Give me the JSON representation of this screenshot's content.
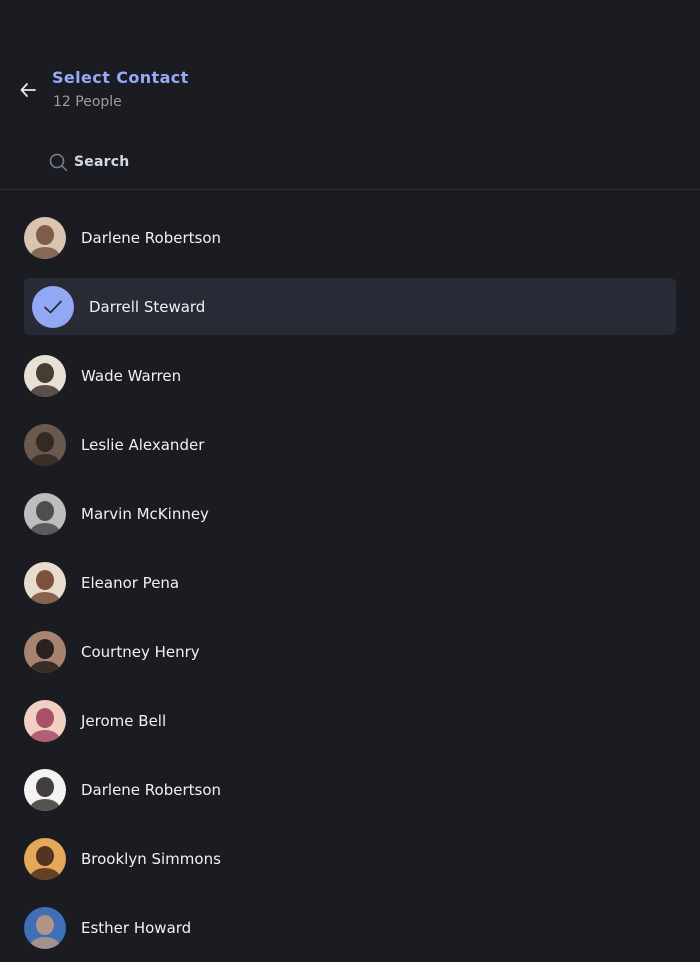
{
  "header": {
    "title": "Select Contact",
    "subtitle": "12 People",
    "back_icon": "arrow-left-icon"
  },
  "search": {
    "label": "Search",
    "icon": "search-icon"
  },
  "colors": {
    "background": "#1b1c22",
    "accent": "#96aaf7",
    "selected_row": "#282b36",
    "check_circle": "#93a8f4"
  },
  "contacts": [
    {
      "name": "Darlene Robertson",
      "selected": false,
      "avatar_colors": [
        "#d8c4b0",
        "#6e4a38"
      ]
    },
    {
      "name": "Darrell Steward",
      "selected": true,
      "avatar_colors": [
        "#93a8f4",
        "#93a8f4"
      ]
    },
    {
      "name": "Wade Warren",
      "selected": false,
      "avatar_colors": [
        "#e7e0d6",
        "#2a1d18"
      ]
    },
    {
      "name": "Leslie Alexander",
      "selected": false,
      "avatar_colors": [
        "#6a5a4e",
        "#2a221d"
      ]
    },
    {
      "name": "Marvin McKinney",
      "selected": false,
      "avatar_colors": [
        "#bdbdbd",
        "#3b3b3b"
      ]
    },
    {
      "name": "Eleanor Pena",
      "selected": false,
      "avatar_colors": [
        "#e8dccf",
        "#6a3a22"
      ]
    },
    {
      "name": "Courtney Henry",
      "selected": false,
      "avatar_colors": [
        "#a8836f",
        "#151010"
      ]
    },
    {
      "name": "Jerome Bell",
      "selected": false,
      "avatar_colors": [
        "#f2cfc3",
        "#9b3b58"
      ]
    },
    {
      "name": "Darlene Robertson",
      "selected": false,
      "avatar_colors": [
        "#f3f3f3",
        "#231d1a"
      ]
    },
    {
      "name": "Brooklyn Simmons",
      "selected": false,
      "avatar_colors": [
        "#e3a85a",
        "#3a1f18"
      ]
    },
    {
      "name": "Esther Howard",
      "selected": false,
      "avatar_colors": [
        "#3e6fb8",
        "#c79b7e"
      ]
    }
  ]
}
